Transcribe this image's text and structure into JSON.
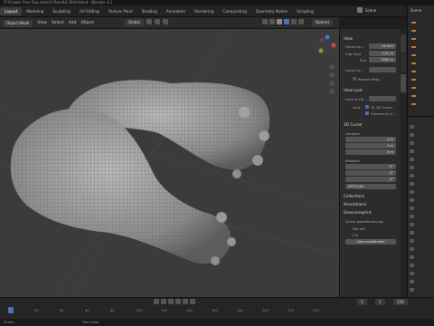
{
  "title_bar": {
    "text": "[F:\\Create Free Dog sketch] Roadkill Bird.blend - Blender 4.1"
  },
  "workspace_tabs": [
    "Layout",
    "Modeling",
    "Sculpting",
    "UV Editing",
    "Texture Paint",
    "Shading",
    "Animation",
    "Rendering",
    "Compositing",
    "Geometry Nodes",
    "Scripting"
  ],
  "active_tab": "Layout",
  "scene_label": "Scene",
  "header": {
    "mode": "Object Mode",
    "menu": [
      "View",
      "Select",
      "Add",
      "Object"
    ],
    "transform": "Global",
    "options": "Options"
  },
  "npanel": {
    "view_section": "View",
    "focal_length_label": "Focal Len...",
    "focal_length_value": "50 mm",
    "clip_start_label": "Clip Start",
    "clip_start_value": "0.01 m",
    "clip_end_label": "End",
    "clip_end_value": "1000 m",
    "local_camera_label": "Local Ca...",
    "render_region": "Render Regi...",
    "view_lock_section": "View Lock",
    "lock_to_object": "Lock to Ob...",
    "lock_label": "Lock",
    "to_3d_cursor": "To 3D Cursor",
    "camera_to_view": "Camera to V...",
    "cursor_section": "3D Cursor",
    "location_label": "Location",
    "loc_x": "0 m",
    "loc_y": "0 m",
    "loc_z": "0 m",
    "rotation_label": "Rotation",
    "rot_x": "0°",
    "rot_y": "0°",
    "rot_z": "0°",
    "rotation_mode": "XYZ Euler",
    "collections": "Collections",
    "annotations": "Annotations",
    "geosceneprint": "Geosceneprint",
    "geoscene_georef": "Scene georeferencing",
    "not_set": "Not set",
    "crs": "Crs",
    "view_coords": "View coordinates"
  },
  "timeline": {
    "ticks": [
      "0",
      "20",
      "40",
      "60",
      "80",
      "100",
      "120",
      "140",
      "160",
      "180",
      "200",
      "220",
      "240"
    ],
    "current_frame": "1",
    "start": "1",
    "end": "250"
  },
  "status": {
    "left": "Select",
    "middle": "Pan View",
    "right": "Scene Brush"
  },
  "outliner": {
    "header": "Scene"
  }
}
